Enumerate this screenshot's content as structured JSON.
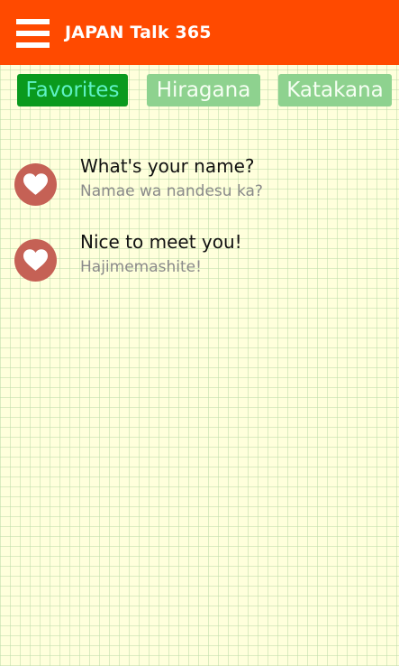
{
  "app_bar": {
    "title": "JAPAN Talk 365",
    "menu_icon": "hamburger-menu-icon",
    "background_color": "#ff4a00"
  },
  "tabs": [
    {
      "label": "Favorites",
      "selected": true
    },
    {
      "label": "Hiragana",
      "selected": false
    },
    {
      "label": "Katakana",
      "selected": false
    }
  ],
  "phrases": [
    {
      "english": "What's your name?",
      "japanese": "Namae wa nandesu ka?",
      "icon": "heart-icon"
    },
    {
      "english": "Nice to meet you!",
      "japanese": "Hajimemashite!",
      "icon": "heart-icon"
    }
  ],
  "colors": {
    "selected_tab": "#0a9a1e",
    "unselected_tab": "#8ed28f",
    "heart_circle": "#c56155",
    "background": "#ffffdc"
  }
}
